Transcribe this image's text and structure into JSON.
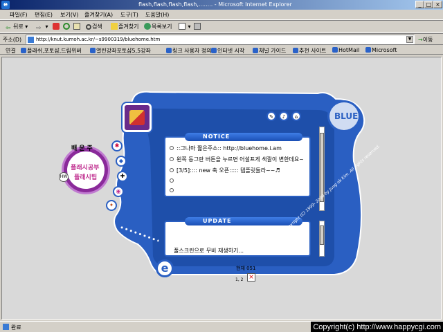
{
  "window": {
    "title": "flash,flash,flash,flash,........ - Microsoft Internet Explorer",
    "minimize": "_",
    "maximize": "□",
    "close": "×"
  },
  "menu": [
    "파일(F)",
    "편집(E)",
    "보기(V)",
    "즐겨찾기(A)",
    "도구(T)",
    "도움말(H)"
  ],
  "toolbar": {
    "back": "뒤로",
    "search": "검색",
    "favorites": "즐겨찾기",
    "history": "목록보기"
  },
  "address": {
    "label": "주소(D)",
    "url": "http://knut.kumoh.ac.kr/~s9900319/bluehome.htm",
    "go": "이동"
  },
  "links": {
    "label": "연결",
    "items": [
      "플래쉬,포토샵,드림위버",
      "열린강좌포토샵5,5강좌",
      "링크 사용자 정의",
      "인터넷 시작",
      "채널 가이드",
      "추천 사이트",
      "HotMail",
      "Microsoft"
    ]
  },
  "flash": {
    "logo": "BLUE",
    "left_menu": {
      "top_text": "배운주",
      "label1": "플래시공부",
      "label2": "플래시팁",
      "side": "HW"
    },
    "notice": {
      "heading": "NOTICE",
      "lines": [
        "::그나마 짧은주소:: http://bluehome.i.am",
        "왼쪽 동그란 버튼을 누르면 어설프게 색깔이 변한데요~",
        "[3/5]:::: new 축 오픈::::: 템플릿들라~~♬",
        "",
        ""
      ]
    },
    "update": {
      "heading": "UPDATE",
      "lines": [
        "풀스크린으로 무비 재생하기..."
      ]
    },
    "counter": "현재 051",
    "counter_sub": "1, 2",
    "close_x": "×",
    "copyright": "Copyright (C) 1999- 2000 by Jung ok Kim. All rights reserved.",
    "e_badge": "e"
  },
  "status": {
    "text": "완료",
    "watermark": "Copyright(c) http://www.happycgi.com"
  }
}
